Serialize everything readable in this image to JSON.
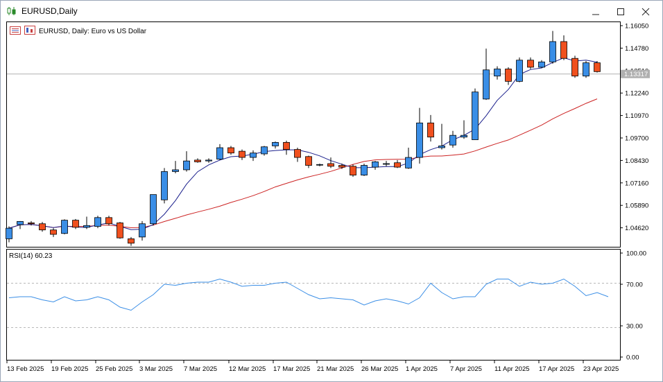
{
  "window": {
    "title": "EURUSD,Daily",
    "icon": "candlestick-chart-icon",
    "controls": [
      "minimize-icon",
      "maximize-icon",
      "close-icon"
    ]
  },
  "chart": {
    "symbol_label": "EURUSD, Daily:  Euro vs US Dollar",
    "current_price_label": "1.13317",
    "price_ticks": [
      "1.16050",
      "1.14780",
      "1.13510",
      "1.12240",
      "1.10970",
      "1.09700",
      "1.08430",
      "1.07160",
      "1.05890",
      "1.04620"
    ],
    "date_ticks": [
      "13 Feb 2025",
      "19 Feb 2025",
      "25 Feb 2025",
      "3 Mar 2025",
      "7 Mar 2025",
      "12 Mar 2025",
      "17 Mar 2025",
      "21 Mar 2025",
      "26 Mar 2025",
      "1 Apr 2025",
      "7 Apr 2025",
      "11 Apr 2025",
      "17 Apr 2025",
      "23 Apr 2025"
    ],
    "rsi_label": "RSI(14) 60.23",
    "rsi_ticks": [
      "100.00",
      "70.00",
      "30.00",
      "0.00"
    ],
    "colors": {
      "bull": "#3a8ee6",
      "bear": "#f0501e",
      "fast_ma": "#1a1f8c",
      "slow_ma": "#cc2222",
      "rsi": "#3a8ee6"
    }
  },
  "chart_data": {
    "type": "candlestick",
    "ylim": [
      1.033,
      1.163
    ],
    "candles": [
      {
        "o": 1.04,
        "h": 1.047,
        "l": 1.038,
        "c": 1.046
      },
      {
        "o": 1.048,
        "h": 1.05,
        "l": 1.0455,
        "c": 1.0498
      },
      {
        "o": 1.049,
        "h": 1.05,
        "l": 1.0475,
        "c": 1.0485
      },
      {
        "o": 1.0485,
        "h": 1.0495,
        "l": 1.044,
        "c": 1.045
      },
      {
        "o": 1.045,
        "h": 1.046,
        "l": 1.041,
        "c": 1.0425
      },
      {
        "o": 1.043,
        "h": 1.051,
        "l": 1.0425,
        "c": 1.0505
      },
      {
        "o": 1.0505,
        "h": 1.0512,
        "l": 1.0455,
        "c": 1.0465
      },
      {
        "o": 1.0465,
        "h": 1.0525,
        "l": 1.0455,
        "c": 1.0475
      },
      {
        "o": 1.047,
        "h": 1.053,
        "l": 1.046,
        "c": 1.052
      },
      {
        "o": 1.052,
        "h": 1.053,
        "l": 1.0475,
        "c": 1.0485
      },
      {
        "o": 1.049,
        "h": 1.0495,
        "l": 1.04,
        "c": 1.0405
      },
      {
        "o": 1.04,
        "h": 1.041,
        "l": 1.036,
        "c": 1.0375
      },
      {
        "o": 1.041,
        "h": 1.05,
        "l": 1.039,
        "c": 1.0485
      },
      {
        "o": 1.0485,
        "h": 1.065,
        "l": 1.0475,
        "c": 1.065
      },
      {
        "o": 1.062,
        "h": 1.08,
        "l": 1.06,
        "c": 1.078
      },
      {
        "o": 1.078,
        "h": 1.084,
        "l": 1.077,
        "c": 1.079
      },
      {
        "o": 1.079,
        "h": 1.0895,
        "l": 1.078,
        "c": 1.084
      },
      {
        "o": 1.0845,
        "h": 1.0855,
        "l": 1.083,
        "c": 1.0835
      },
      {
        "o": 1.084,
        "h": 1.0855,
        "l": 1.083,
        "c": 1.0845
      },
      {
        "o": 1.085,
        "h": 1.0935,
        "l": 1.0845,
        "c": 1.0915
      },
      {
        "o": 1.0915,
        "h": 1.0925,
        "l": 1.0875,
        "c": 1.0885
      },
      {
        "o": 1.0895,
        "h": 1.0905,
        "l": 1.0845,
        "c": 1.086
      },
      {
        "o": 1.086,
        "h": 1.09,
        "l": 1.084,
        "c": 1.0885
      },
      {
        "o": 1.088,
        "h": 1.0925,
        "l": 1.087,
        "c": 1.092
      },
      {
        "o": 1.0925,
        "h": 1.095,
        "l": 1.091,
        "c": 1.0945
      },
      {
        "o": 1.0945,
        "h": 1.0955,
        "l": 1.0875,
        "c": 1.0905
      },
      {
        "o": 1.0905,
        "h": 1.0915,
        "l": 1.0835,
        "c": 1.086
      },
      {
        "o": 1.0865,
        "h": 1.087,
        "l": 1.08,
        "c": 1.0815
      },
      {
        "o": 1.082,
        "h": 1.0825,
        "l": 1.081,
        "c": 1.082
      },
      {
        "o": 1.0825,
        "h": 1.086,
        "l": 1.08,
        "c": 1.081
      },
      {
        "o": 1.0815,
        "h": 1.0825,
        "l": 1.0795,
        "c": 1.0805
      },
      {
        "o": 1.081,
        "h": 1.082,
        "l": 1.075,
        "c": 1.076
      },
      {
        "o": 1.076,
        "h": 1.0825,
        "l": 1.0755,
        "c": 1.0815
      },
      {
        "o": 1.0805,
        "h": 1.084,
        "l": 1.079,
        "c": 1.0835
      },
      {
        "o": 1.0825,
        "h": 1.084,
        "l": 1.081,
        "c": 1.0825
      },
      {
        "o": 1.083,
        "h": 1.0845,
        "l": 1.08,
        "c": 1.0805
      },
      {
        "o": 1.08,
        "h": 1.0915,
        "l": 1.0795,
        "c": 1.086
      },
      {
        "o": 1.086,
        "h": 1.114,
        "l": 1.0825,
        "c": 1.1055
      },
      {
        "o": 1.1055,
        "h": 1.11,
        "l": 1.095,
        "c": 1.0975
      },
      {
        "o": 1.0915,
        "h": 1.105,
        "l": 1.0905,
        "c": 1.0925
      },
      {
        "o": 1.093,
        "h": 1.101,
        "l": 1.0915,
        "c": 1.0985
      },
      {
        "o": 1.0975,
        "h": 1.107,
        "l": 1.0965,
        "c": 1.0985
      },
      {
        "o": 1.096,
        "h": 1.125,
        "l": 1.096,
        "c": 1.123
      },
      {
        "o": 1.119,
        "h": 1.1475,
        "l": 1.1185,
        "c": 1.1355
      },
      {
        "o": 1.132,
        "h": 1.1375,
        "l": 1.13,
        "c": 1.136
      },
      {
        "o": 1.136,
        "h": 1.137,
        "l": 1.127,
        "c": 1.129
      },
      {
        "o": 1.129,
        "h": 1.1425,
        "l": 1.1285,
        "c": 1.141
      },
      {
        "o": 1.141,
        "h": 1.1425,
        "l": 1.136,
        "c": 1.137
      },
      {
        "o": 1.137,
        "h": 1.141,
        "l": 1.1365,
        "c": 1.14
      },
      {
        "o": 1.14,
        "h": 1.1575,
        "l": 1.139,
        "c": 1.1515
      },
      {
        "o": 1.1515,
        "h": 1.155,
        "l": 1.141,
        "c": 1.142
      },
      {
        "o": 1.142,
        "h": 1.1435,
        "l": 1.131,
        "c": 1.132
      },
      {
        "o": 1.132,
        "h": 1.1405,
        "l": 1.131,
        "c": 1.1395
      },
      {
        "o": 1.1395,
        "h": 1.1405,
        "l": 1.134,
        "c": 1.1345
      }
    ],
    "rsi": [
      57,
      58,
      58,
      55,
      53,
      58,
      54,
      55,
      58,
      55,
      48,
      45,
      53,
      60,
      70,
      69,
      71,
      72,
      72,
      75,
      72,
      68,
      69,
      69,
      71,
      72,
      66,
      60,
      56,
      57,
      56,
      55,
      50,
      54,
      56,
      54,
      51,
      57,
      71,
      62,
      56,
      58,
      58,
      70,
      75,
      75,
      68,
      72,
      70,
      71,
      75,
      68,
      59,
      62,
      58
    ]
  }
}
